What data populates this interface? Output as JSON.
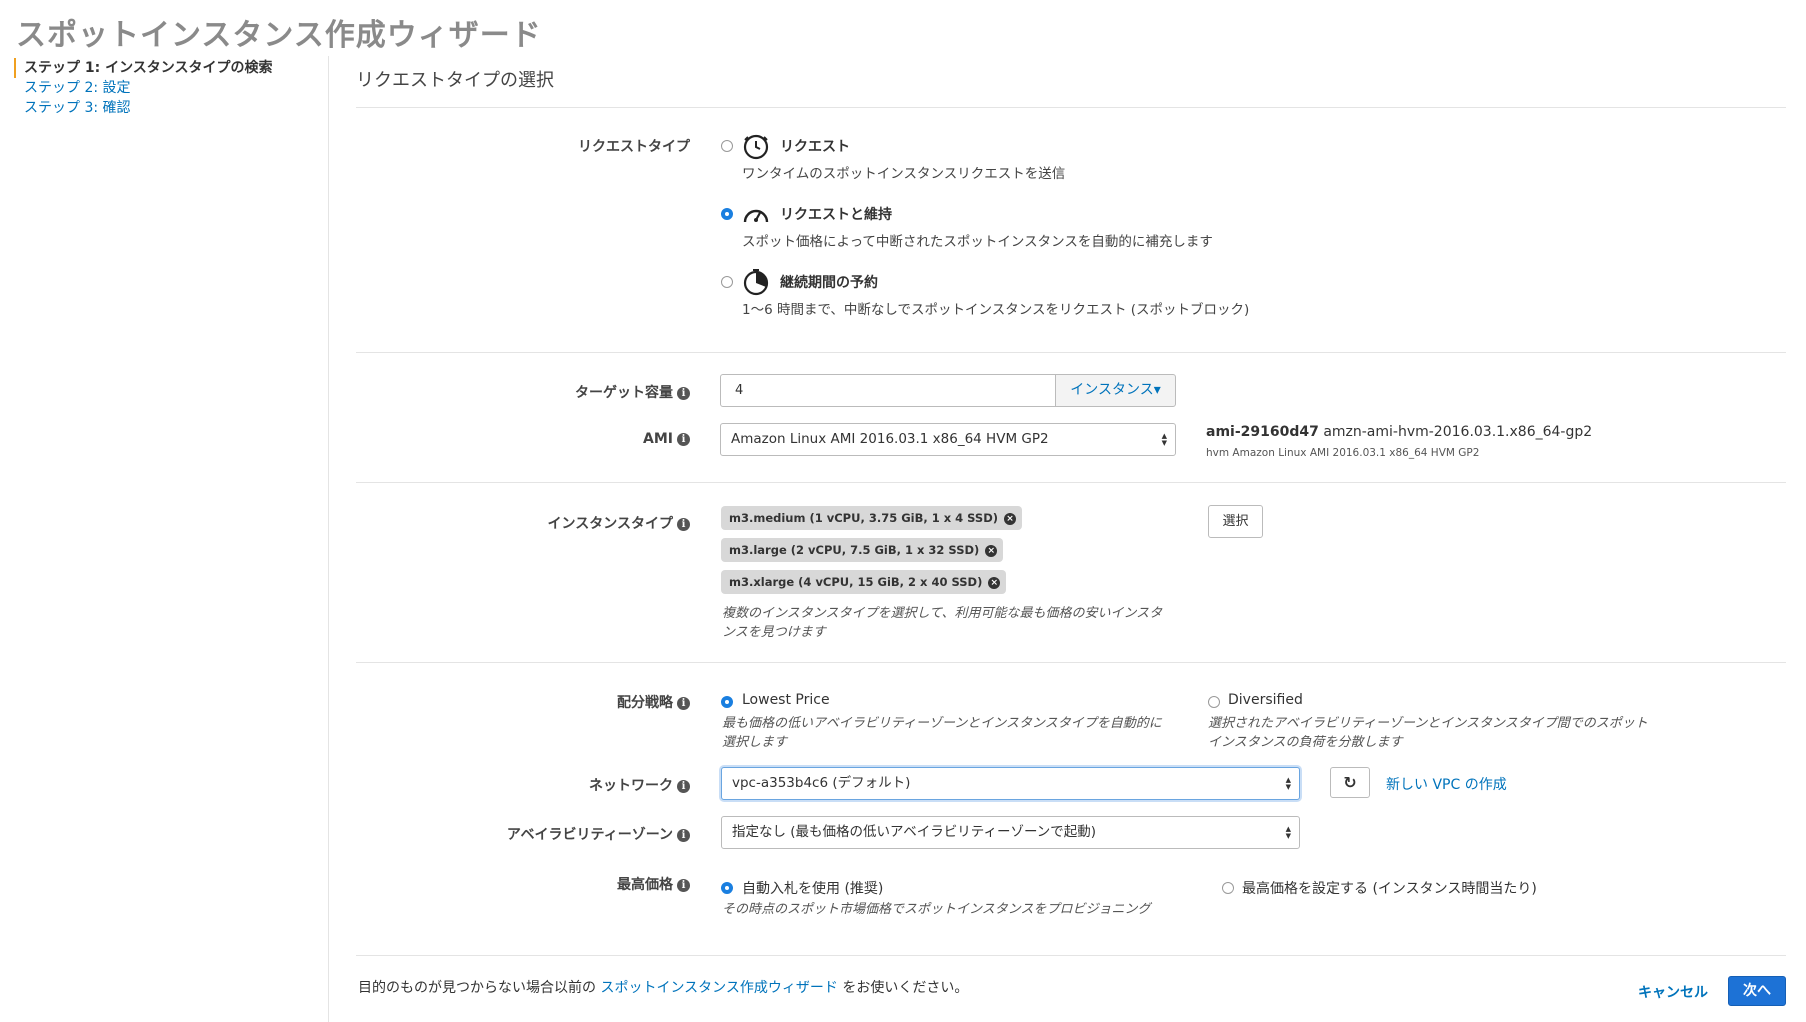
{
  "page_title": "スポットインスタンス作成ウィザード",
  "steps": [
    {
      "label": "ステップ 1: インスタンスタイプの検索",
      "active": true
    },
    {
      "label": "ステップ 2: 設定",
      "active": false
    },
    {
      "label": "ステップ 3: 確認",
      "active": false
    }
  ],
  "section_title": "リクエストタイプの選択",
  "request_type": {
    "label": "リクエストタイプ",
    "options": [
      {
        "title": "リクエスト",
        "desc": "ワンタイムのスポットインスタンスリクエストを送信",
        "selected": false,
        "icon": "clock-icon"
      },
      {
        "title": "リクエストと維持",
        "desc": "スポット価格によって中断されたスポットインスタンスを自動的に補充します",
        "selected": true,
        "icon": "speedometer-icon"
      },
      {
        "title": "継続期間の予約",
        "desc": "1〜6 時間まで、中断なしでスポットインスタンスをリクエスト (スポットブロック)",
        "selected": false,
        "icon": "timer-icon"
      }
    ]
  },
  "target_capacity": {
    "label": "ターゲット容量",
    "value": "4",
    "unit_button": "インスタンス▾"
  },
  "ami": {
    "label": "AMI",
    "selected": "Amazon Linux AMI 2016.03.1 x86_64 HVM GP2",
    "id": "ami-29160d47",
    "name": "amzn-ami-hvm-2016.03.1.x86_64-gp2",
    "description": "hvm Amazon Linux AMI 2016.03.1 x86_64 HVM GP2"
  },
  "instance_types": {
    "label": "インスタンスタイプ",
    "chips": [
      "m3.medium (1 vCPU, 3.75 GiB, 1 x 4 SSD)",
      "m3.large (2 vCPU, 7.5 GiB, 1 x 32 SSD)",
      "m3.xlarge (4 vCPU, 15 GiB, 2 x 40 SSD)"
    ],
    "select_button": "選択",
    "hint_line1": "複数のインスタンスタイプを選択して、利用可能な最も価格の安いインスタ",
    "hint_line2": "ンスを見つけます"
  },
  "allocation": {
    "label": "配分戦略",
    "option1": {
      "title": "Lowest Price",
      "desc1": "最も価格の低いアベイラビリティーゾーンとインスタンスタイプを自動的に",
      "desc2": "選択します",
      "selected": true
    },
    "option2": {
      "title": "Diversified",
      "desc1": "選択されたアベイラビリティーゾーンとインスタンスタイプ間でのスポット",
      "desc2": "インスタンスの負荷を分散します",
      "selected": false
    }
  },
  "network": {
    "label": "ネットワーク",
    "selected": "vpc-a353b4c6 (デフォルト)",
    "new_vpc_link": "新しい VPC の作成"
  },
  "availability_zone": {
    "label": "アベイラビリティーゾーン",
    "selected": "指定なし (最も価格の低いアベイラビリティーゾーンで起動)"
  },
  "max_price": {
    "label": "最高価格",
    "option1": {
      "title": "自動入札を使用 (推奨)",
      "desc": "その時点のスポット市場価格でスポットインスタンスをプロビジョニング",
      "selected": true
    },
    "option2": {
      "title": "最高価格を設定する (インスタンス時間当たり)",
      "selected": false
    }
  },
  "footer": {
    "text_before": "目的のものが見つからない場合以前の ",
    "link": "スポットインスタンス作成ウィザード",
    "text_after": " をお使いください。",
    "cancel": "キャンセル",
    "next": "次へ"
  },
  "info_glyph": "i",
  "remove_glyph": "×",
  "refresh_glyph": "↻",
  "colors": {
    "link": "#0073bb",
    "primary_button": "#1d72d6",
    "radio_selected": "#1a7fe0",
    "step_marker": "#f0a020"
  }
}
